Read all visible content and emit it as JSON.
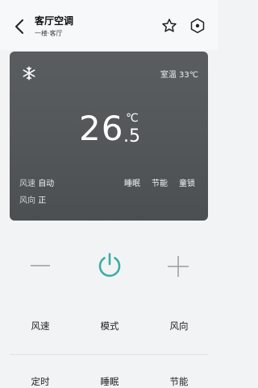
{
  "header": {
    "title": "客厅空调",
    "subtitle": "一楼·客厅"
  },
  "status": {
    "room_label": "室温",
    "room_value": "33℃",
    "temp_int": "26",
    "temp_unit": "℃",
    "temp_decimal": ".5",
    "fan_label": "风速",
    "fan_value": "自动",
    "dir_label": "风向",
    "dir_value": "正",
    "modes": [
      "睡眠",
      "节能",
      "童锁"
    ]
  },
  "controls": {
    "row1": [
      "风速",
      "模式",
      "风向"
    ],
    "row2": [
      "定时",
      "睡眠",
      "节能"
    ]
  },
  "colors": {
    "accent": "#3aaea5"
  }
}
